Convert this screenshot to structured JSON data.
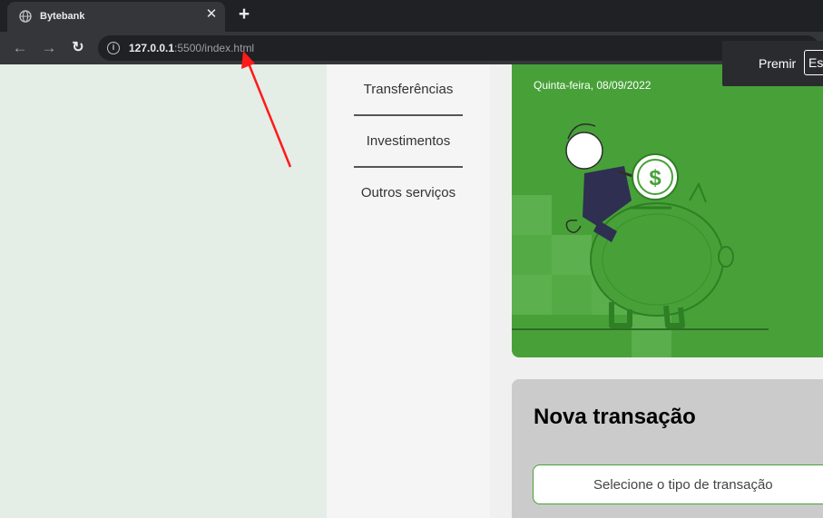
{
  "browser": {
    "tab": {
      "title": "Bytebank",
      "close_glyph": "✕",
      "icon": "globe-icon"
    },
    "new_tab_glyph": "+",
    "toolbar": {
      "back_glyph": "←",
      "forward_glyph": "→",
      "reload_glyph": "↻"
    },
    "address": {
      "info_glyph": "i",
      "host": "127.0.0.1",
      "rest": ":5500/index.html"
    }
  },
  "esc_notice": {
    "text": "Premir",
    "key": "Esc"
  },
  "menu": {
    "items": [
      {
        "label": "Transferências"
      },
      {
        "label": "Investimentos"
      },
      {
        "label": "Outros serviços"
      }
    ]
  },
  "hero": {
    "date": "Quinta-feira, 08/09/2022",
    "coin_symbol": "$"
  },
  "transaction": {
    "title": "Nova transação",
    "select_placeholder": "Selecione o tipo de transação"
  },
  "colors": {
    "brand_green": "#47a138",
    "chrome_dark": "#202124",
    "chrome_toolbar": "#35363a",
    "page_bg": "#e4ede6",
    "card_gray": "#cbcbcb",
    "annotation_red": "#ff1a1a"
  }
}
